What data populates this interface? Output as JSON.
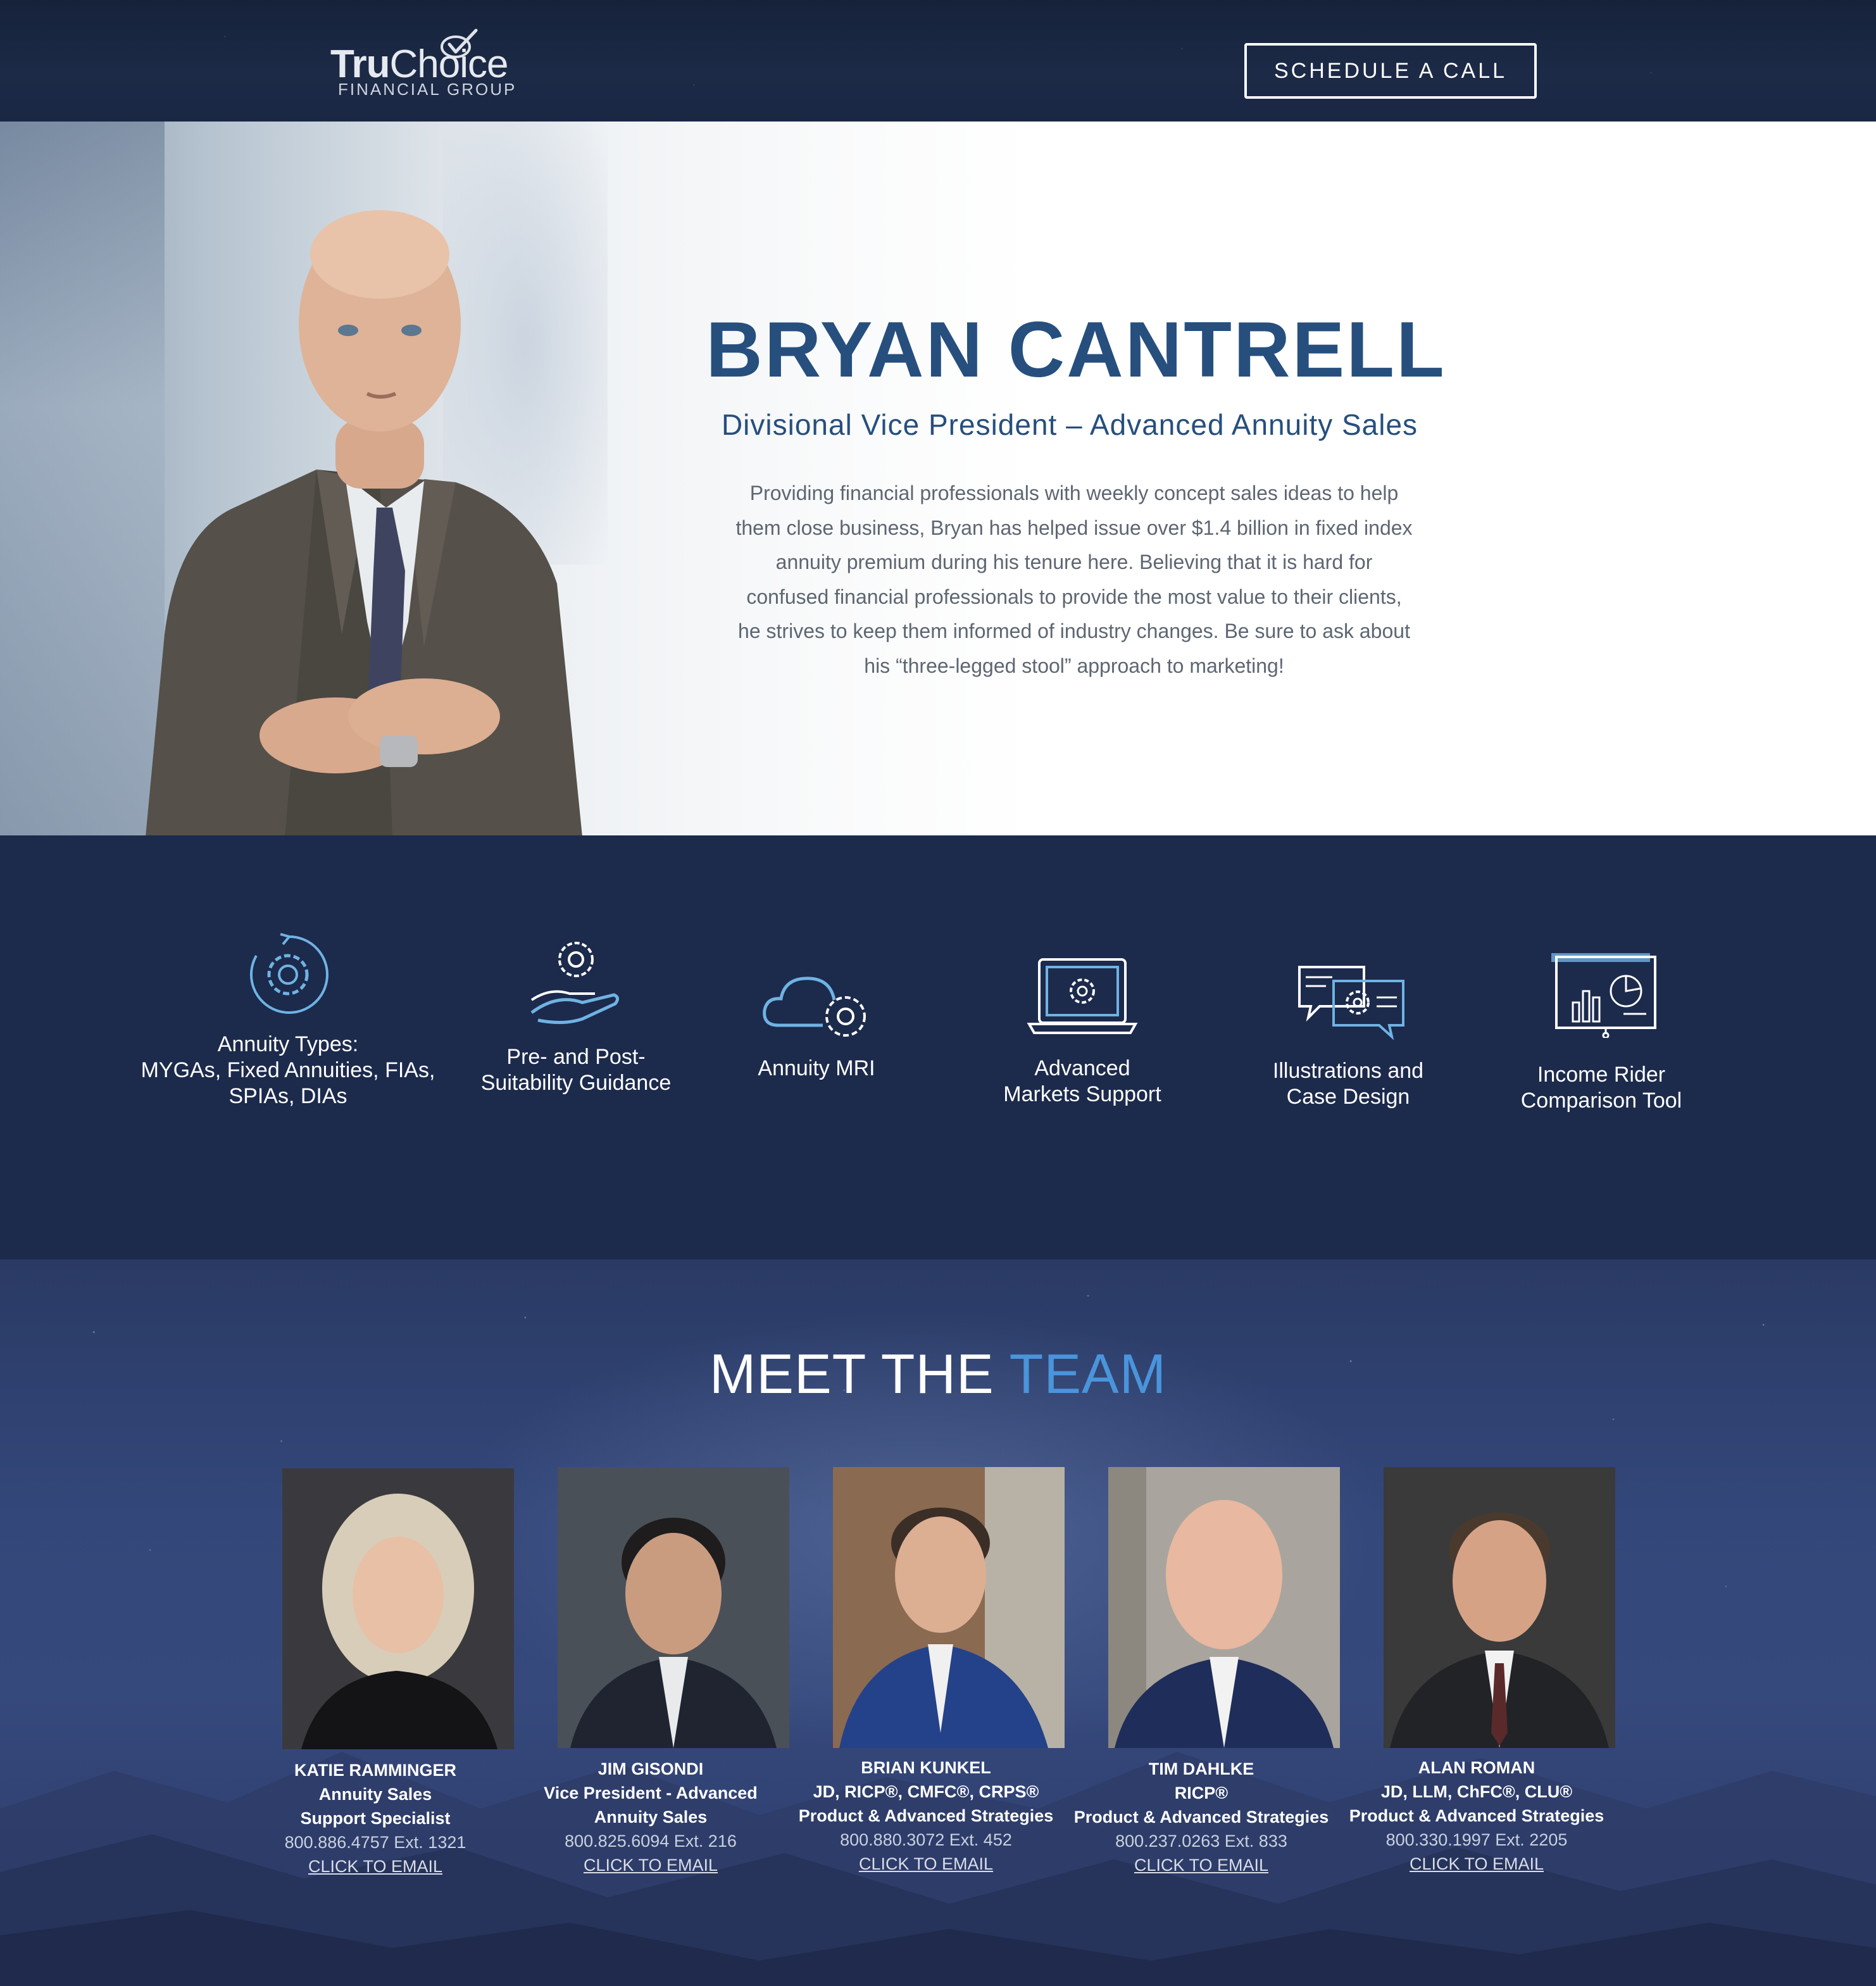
{
  "header": {
    "logo": {
      "word_bold": "Tru",
      "word_regular": "Choice",
      "sub": "FINANCIAL GROUP"
    },
    "cta_label": "SCHEDULE A CALL"
  },
  "hero": {
    "name": "BRYAN CANTRELL",
    "title": "Divisional Vice President – Advanced Annuity Sales",
    "bio": "Providing financial professionals with weekly concept sales ideas to help them close business, Bryan has helped issue over $1.4 billion in fixed index annuity premium during his tenure here. Believing that it is hard for confused financial professionals to provide the most value to their clients, he strives to keep them informed of industry changes. Be sure to ask about his “three-legged stool” approach to marketing!"
  },
  "services": [
    {
      "icon": "gear-cycle-icon",
      "lines": [
        "Annuity Types:",
        "MYGAs, Fixed Annuities, FIAs,",
        "SPIAs, DIAs"
      ]
    },
    {
      "icon": "hand-gear-icon",
      "lines": [
        "Pre- and Post-",
        "Suitability Guidance"
      ]
    },
    {
      "icon": "cloud-gear-icon",
      "lines": [
        "Annuity MRI"
      ]
    },
    {
      "icon": "laptop-gear-icon",
      "lines": [
        "Advanced",
        "Markets Support"
      ]
    },
    {
      "icon": "chat-gear-icon",
      "lines": [
        "Illustrations and",
        "Case Design"
      ]
    },
    {
      "icon": "presentation-chart-icon",
      "lines": [
        "Income Rider",
        "Comparison Tool"
      ]
    }
  ],
  "team": {
    "heading_main": "MEET THE",
    "heading_accent": "TEAM",
    "members": [
      {
        "name": "KATIE RAMMINGER",
        "roles": [
          "Annuity Sales",
          "Support Specialist"
        ],
        "phone": "800.886.4757 Ext. 1321",
        "email_label": "CLICK TO EMAIL"
      },
      {
        "name": "JIM GISONDI",
        "roles": [
          "Vice President - Advanced",
          "Annuity Sales"
        ],
        "phone": "800.825.6094 Ext. 216",
        "email_label": "CLICK TO EMAIL"
      },
      {
        "name": "BRIAN KUNKEL",
        "roles": [
          "JD, RICP®, CMFC®, CRPS®",
          "Product & Advanced Strategies"
        ],
        "phone": "800.880.3072 Ext. 452",
        "email_label": "CLICK TO EMAIL"
      },
      {
        "name": "TIM DAHLKE",
        "roles": [
          "RICP®",
          "Product & Advanced Strategies"
        ],
        "phone": "800.237.0263 Ext. 833",
        "email_label": "CLICK TO EMAIL"
      },
      {
        "name": "ALAN ROMAN",
        "roles": [
          "JD, LLM, ChFC®, CLU®",
          "Product & Advanced Strategies"
        ],
        "phone": "800.330.1997 Ext. 2205",
        "email_label": "CLICK TO EMAIL"
      }
    ]
  },
  "colors": {
    "navy": "#1c2a4c",
    "hero_blue": "#264f7e",
    "accent_blue": "#4a94db",
    "icon_blue": "#6fb3e3"
  }
}
